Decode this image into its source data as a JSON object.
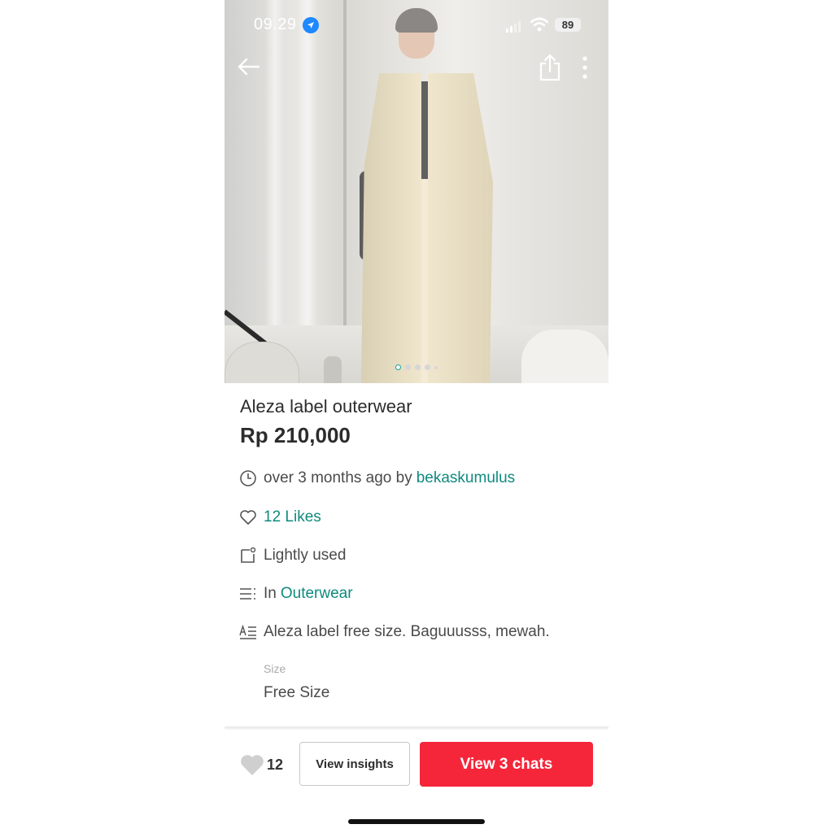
{
  "status_bar": {
    "time": "09.29",
    "battery": "89"
  },
  "product": {
    "title": "Aleza label outerwear",
    "price": "Rp 210,000",
    "posted": "over 3 months ago by",
    "seller": "bekaskumulus",
    "likes": "12 Likes",
    "condition": "Lightly used",
    "category_prefix": "In",
    "category": "Outerwear",
    "description": "Aleza label free size. Baguuusss, mewah.",
    "size_label": "Size",
    "size_value": "Free Size"
  },
  "image_carousel": {
    "total_dots": 5,
    "active_index": 0
  },
  "bottom_bar": {
    "like_count": "12",
    "insights_label": "View insights",
    "chats_label": "View 3 chats"
  },
  "colors": {
    "accent": "#0f8a7e",
    "cta": "#f5263a"
  },
  "icons": [
    "back-arrow-icon",
    "share-icon",
    "more-vertical-icon",
    "clock-icon",
    "heart-icon",
    "condition-tag-icon",
    "list-icon",
    "description-icon",
    "location-arrow-icon",
    "wifi-icon",
    "signal-icon",
    "battery-icon"
  ]
}
